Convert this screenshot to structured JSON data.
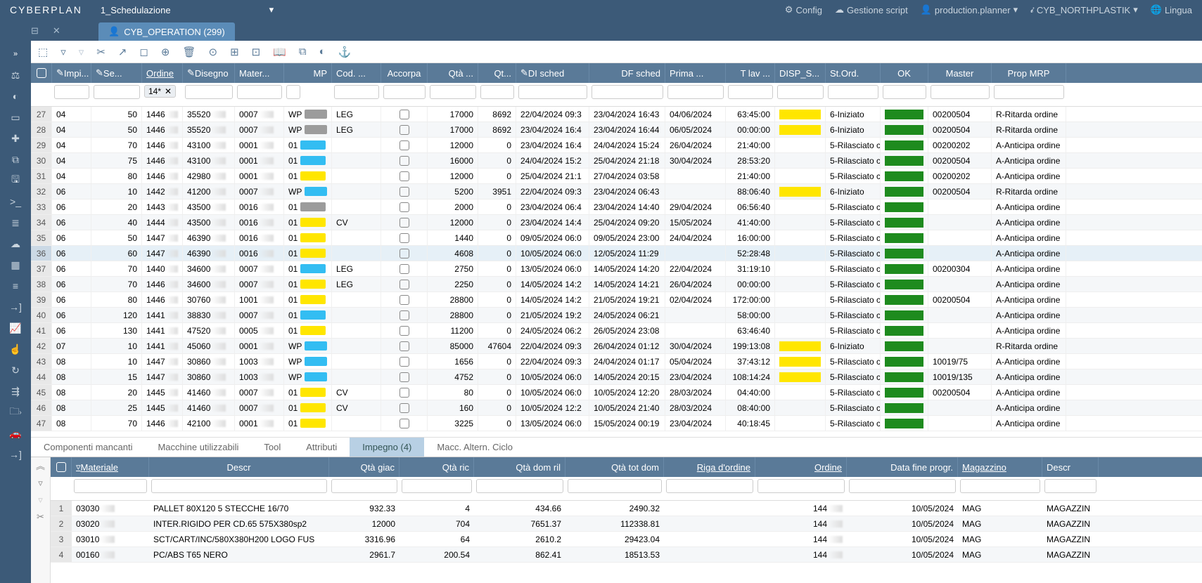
{
  "app": {
    "logo": "CYBERPLAN",
    "schedule": "1_Schedulazione"
  },
  "top_right": {
    "config": "Config",
    "script": "Gestione script",
    "user": "production.planner",
    "plant": "CYB_NORTHPLASTIK",
    "lang": "Lingua"
  },
  "tab": {
    "title": "CYB_OPERATION  (299)"
  },
  "filter_chip": "14*",
  "headers": [
    "",
    "Impi...",
    "Se...",
    "Ordine",
    "Disegno",
    "Mater...",
    "MP",
    "Cod. ...",
    "Accorpa",
    "Qtà ...",
    "Qt...",
    "DI sched",
    "DF sched",
    "Prima ...",
    "T lav ...",
    "DISP_S...",
    "St.Ord.",
    "OK",
    "Master",
    "Prop MRP"
  ],
  "rows": [
    {
      "idx": 27,
      "a": "04",
      "se": 50,
      "ord": "1446",
      "dis": "35520",
      "mat": "0007",
      "mp": "WP",
      "mpc": "gray",
      "cod": "LEG",
      "qta": 17000,
      "qt2": 8692,
      "di": "22/04/2024 09:3",
      "df": "23/04/2024 16:43",
      "prima": "04/06/2024",
      "tlav": "63:45:00",
      "disp": "y",
      "stord": "6-Iniziato",
      "mast": "00200504",
      "prop": "R-Ritarda ordine"
    },
    {
      "idx": 28,
      "a": "04",
      "se": 50,
      "ord": "1446",
      "dis": "35520",
      "mat": "0007",
      "mp": "WP",
      "mpc": "gray",
      "cod": "LEG",
      "qta": 17000,
      "qt2": 8692,
      "di": "23/04/2024 16:4",
      "df": "23/04/2024 16:44",
      "prima": "06/05/2024",
      "tlav": "00:00:00",
      "disp": "y",
      "stord": "6-Iniziato",
      "mast": "00200504",
      "prop": "R-Ritarda ordine"
    },
    {
      "idx": 29,
      "a": "04",
      "se": 70,
      "ord": "1446",
      "dis": "43100",
      "mat": "0001",
      "mp": "01",
      "mpc": "cyan",
      "cod": "",
      "qta": 12000,
      "qt2": 0,
      "di": "23/04/2024 16:4",
      "df": "24/04/2024 15:24",
      "prima": "26/04/2024",
      "tlav": "21:40:00",
      "disp": "",
      "stord": "5-Rilasciato c",
      "mast": "00200202",
      "prop": "A-Anticipa ordine"
    },
    {
      "idx": 30,
      "a": "04",
      "se": 75,
      "ord": "1446",
      "dis": "43100",
      "mat": "0001",
      "mp": "01",
      "mpc": "cyan",
      "cod": "",
      "qta": 16000,
      "qt2": 0,
      "di": "24/04/2024 15:2",
      "df": "25/04/2024 21:18",
      "prima": "30/04/2024",
      "tlav": "28:53:20",
      "disp": "",
      "stord": "5-Rilasciato c",
      "mast": "00200504",
      "prop": "A-Anticipa ordine"
    },
    {
      "idx": 31,
      "a": "04",
      "se": 80,
      "ord": "1446",
      "dis": "42980",
      "mat": "0001",
      "mp": "01",
      "mpc": "yellow",
      "cod": "",
      "qta": 12000,
      "qt2": 0,
      "di": "25/04/2024 21:1",
      "df": "27/04/2024 03:58",
      "prima": "",
      "tlav": "21:40:00",
      "disp": "",
      "stord": "5-Rilasciato c",
      "mast": "00200202",
      "prop": "A-Anticipa ordine"
    },
    {
      "idx": 32,
      "a": "06",
      "se": 10,
      "ord": "1442",
      "dis": "41200",
      "mat": "0007",
      "mp": "WP",
      "mpc": "cyan",
      "cod": "",
      "qta": 5200,
      "qt2": 3951,
      "di": "22/04/2024 09:3",
      "df": "23/04/2024 06:43",
      "prima": "",
      "tlav": "88:06:40",
      "disp": "y",
      "stord": "6-Iniziato",
      "mast": "00200504",
      "prop": "R-Ritarda ordine"
    },
    {
      "idx": 33,
      "a": "06",
      "se": 20,
      "ord": "1443",
      "dis": "43500",
      "mat": "0016",
      "mp": "01",
      "mpc": "gray",
      "cod": "",
      "qta": 2000,
      "qt2": 0,
      "di": "23/04/2024 06:4",
      "df": "23/04/2024 14:40",
      "prima": "29/04/2024",
      "tlav": "06:56:40",
      "disp": "",
      "stord": "5-Rilasciato c",
      "mast": "",
      "prop": "A-Anticipa ordine"
    },
    {
      "idx": 34,
      "a": "06",
      "se": 40,
      "ord": "1444",
      "dis": "43500",
      "mat": "0016",
      "mp": "01",
      "mpc": "yellow",
      "cod": "CV",
      "qta": 12000,
      "qt2": 0,
      "di": "23/04/2024 14:4",
      "df": "25/04/2024 09:20",
      "prima": "15/05/2024",
      "tlav": "41:40:00",
      "disp": "",
      "stord": "5-Rilasciato c",
      "mast": "",
      "prop": "A-Anticipa ordine"
    },
    {
      "idx": 35,
      "a": "06",
      "se": 50,
      "ord": "1447",
      "dis": "46390",
      "mat": "0016",
      "mp": "01",
      "mpc": "yellow",
      "cod": "",
      "qta": 1440,
      "qt2": 0,
      "di": "09/05/2024 06:0",
      "df": "09/05/2024 23:00",
      "prima": "24/04/2024",
      "tlav": "16:00:00",
      "disp": "",
      "stord": "5-Rilasciato c",
      "mast": "",
      "prop": "A-Anticipa ordine"
    },
    {
      "idx": 36,
      "a": "06",
      "se": 60,
      "ord": "1447",
      "dis": "46390",
      "mat": "0016",
      "mp": "01",
      "mpc": "yellow",
      "cod": "",
      "qta": 4608,
      "qt2": 0,
      "di": "10/05/2024 06:0",
      "df": "12/05/2024 11:29",
      "prima": "",
      "tlav": "52:28:48",
      "disp": "",
      "stord": "5-Rilasciato c",
      "mast": "",
      "prop": "A-Anticipa ordine",
      "sel": true
    },
    {
      "idx": 37,
      "a": "06",
      "se": 70,
      "ord": "1440",
      "dis": "34600",
      "mat": "0007",
      "mp": "01",
      "mpc": "cyan",
      "cod": "LEG",
      "qta": 2750,
      "qt2": 0,
      "di": "13/05/2024 06:0",
      "df": "14/05/2024 14:20",
      "prima": "22/04/2024",
      "tlav": "31:19:10",
      "disp": "",
      "stord": "5-Rilasciato c",
      "mast": "00200304",
      "prop": "A-Anticipa ordine"
    },
    {
      "idx": 38,
      "a": "06",
      "se": 70,
      "ord": "1446",
      "dis": "34600",
      "mat": "0007",
      "mp": "01",
      "mpc": "yellow",
      "cod": "LEG",
      "qta": 2250,
      "qt2": 0,
      "di": "14/05/2024 14:2",
      "df": "14/05/2024 14:21",
      "prima": "26/04/2024",
      "tlav": "00:00:00",
      "disp": "",
      "stord": "5-Rilasciato c",
      "mast": "",
      "prop": "A-Anticipa ordine"
    },
    {
      "idx": 39,
      "a": "06",
      "se": 80,
      "ord": "1446",
      "dis": "30760",
      "mat": "1001",
      "mp": "01",
      "mpc": "yellow",
      "cod": "",
      "qta": 28800,
      "qt2": 0,
      "di": "14/05/2024 14:2",
      "df": "21/05/2024 19:21",
      "prima": "02/04/2024",
      "tlav": "172:00:00",
      "disp": "",
      "stord": "5-Rilasciato c",
      "mast": "00200504",
      "prop": "A-Anticipa ordine"
    },
    {
      "idx": 40,
      "a": "06",
      "se": 120,
      "ord": "1441",
      "dis": "38830",
      "mat": "0007",
      "mp": "01",
      "mpc": "cyan",
      "cod": "",
      "qta": 28800,
      "qt2": 0,
      "di": "21/05/2024 19:2",
      "df": "24/05/2024 06:21",
      "prima": "",
      "tlav": "58:00:00",
      "disp": "",
      "stord": "5-Rilasciato c",
      "mast": "",
      "prop": "A-Anticipa ordine"
    },
    {
      "idx": 41,
      "a": "06",
      "se": 130,
      "ord": "1441",
      "dis": "47520",
      "mat": "0005",
      "mp": "01",
      "mpc": "yellow",
      "cod": "",
      "qta": 11200,
      "qt2": 0,
      "di": "24/05/2024 06:2",
      "df": "26/05/2024 23:08",
      "prima": "",
      "tlav": "63:46:40",
      "disp": "",
      "stord": "5-Rilasciato c",
      "mast": "",
      "prop": "A-Anticipa ordine"
    },
    {
      "idx": 42,
      "a": "07",
      "se": 10,
      "ord": "1441",
      "dis": "45060",
      "mat": "0001",
      "mp": "WP",
      "mpc": "cyan",
      "cod": "",
      "qta": 85000,
      "qt2": 47604,
      "di": "22/04/2024 09:3",
      "df": "26/04/2024 01:12",
      "prima": "30/04/2024",
      "tlav": "199:13:08",
      "disp": "y",
      "stord": "6-Iniziato",
      "mast": "",
      "prop": "R-Ritarda ordine"
    },
    {
      "idx": 43,
      "a": "08",
      "se": 10,
      "ord": "1447",
      "dis": "30860",
      "mat": "1003",
      "mp": "WP",
      "mpc": "cyan",
      "cod": "",
      "qta": 1656,
      "qt2": 0,
      "di": "22/04/2024 09:3",
      "df": "24/04/2024 01:17",
      "prima": "05/04/2024",
      "tlav": "37:43:12",
      "disp": "y",
      "stord": "5-Rilasciato c",
      "mast": "10019/75",
      "prop": "A-Anticipa ordine"
    },
    {
      "idx": 44,
      "a": "08",
      "se": 15,
      "ord": "1447",
      "dis": "30860",
      "mat": "1003",
      "mp": "WP",
      "mpc": "cyan",
      "cod": "",
      "qta": 4752,
      "qt2": 0,
      "di": "10/05/2024 06:0",
      "df": "14/05/2024 20:15",
      "prima": "23/04/2024",
      "tlav": "108:14:24",
      "disp": "y",
      "stord": "5-Rilasciato c",
      "mast": "10019/135",
      "prop": "A-Anticipa ordine"
    },
    {
      "idx": 45,
      "a": "08",
      "se": 20,
      "ord": "1445",
      "dis": "41460",
      "mat": "0007",
      "mp": "01",
      "mpc": "yellow",
      "cod": "CV",
      "qta": 80,
      "qt2": 0,
      "di": "10/05/2024 06:0",
      "df": "10/05/2024 12:20",
      "prima": "28/03/2024",
      "tlav": "04:40:00",
      "disp": "",
      "stord": "5-Rilasciato c",
      "mast": "00200504",
      "prop": "A-Anticipa ordine"
    },
    {
      "idx": 46,
      "a": "08",
      "se": 25,
      "ord": "1445",
      "dis": "41460",
      "mat": "0007",
      "mp": "01",
      "mpc": "yellow",
      "cod": "CV",
      "qta": 160,
      "qt2": 0,
      "di": "10/05/2024 12:2",
      "df": "10/05/2024 21:40",
      "prima": "28/03/2024",
      "tlav": "08:40:00",
      "disp": "",
      "stord": "5-Rilasciato c",
      "mast": "",
      "prop": "A-Anticipa ordine"
    },
    {
      "idx": 47,
      "a": "08",
      "se": 70,
      "ord": "1446",
      "dis": "42100",
      "mat": "0001",
      "mp": "01",
      "mpc": "yellow",
      "cod": "",
      "qta": 3225,
      "qt2": 0,
      "di": "13/05/2024 06:0",
      "df": "15/05/2024 00:19",
      "prima": "23/04/2024",
      "tlav": "40:18:45",
      "disp": "",
      "stord": "5-Rilasciato c",
      "mast": "",
      "prop": "A-Anticipa ordine"
    }
  ],
  "sub_tabs": [
    "Componenti mancanti",
    "Macchine utilizzabili",
    "Tool",
    "Attributi",
    "Impegno (4)",
    "Macc. Altern. Ciclo"
  ],
  "sub_active": 4,
  "lower_headers": [
    "Materiale",
    "Descr",
    "Qtà giac",
    "Qtà ric",
    "Qtà dom ril",
    "Qtà tot dom",
    "Riga d'ordine",
    "Ordine",
    "Data fine progr.",
    "Magazzino",
    "Descr"
  ],
  "lower_rows": [
    {
      "idx": 1,
      "mat": "03030",
      "desc": "PALLET 80X120 5 STECCHE 16/70",
      "giac": "932.33",
      "ric": "4",
      "dom": "434.66",
      "tot": "2490.32",
      "riga": "",
      "ord": "144",
      "data": "10/05/2024",
      "mag": "MAG",
      "d2": "MAGAZZIN"
    },
    {
      "idx": 2,
      "mat": "03020",
      "desc": "INTER.RIGIDO PER CD.65 575X380sp2",
      "giac": "12000",
      "ric": "704",
      "dom": "7651.37",
      "tot": "112338.81",
      "riga": "",
      "ord": "144",
      "data": "10/05/2024",
      "mag": "MAG",
      "d2": "MAGAZZIN"
    },
    {
      "idx": 3,
      "mat": "03010",
      "desc": "SCT/CART/INC/580X380H200 LOGO FUS",
      "giac": "3316.96",
      "ric": "64",
      "dom": "2610.2",
      "tot": "29423.04",
      "riga": "",
      "ord": "144",
      "data": "10/05/2024",
      "mag": "MAG",
      "d2": "MAGAZZIN"
    },
    {
      "idx": 4,
      "mat": "00160",
      "desc": "PC/ABS T65 NERO",
      "giac": "2961.7",
      "ric": "200.54",
      "dom": "862.41",
      "tot": "18513.53",
      "riga": "",
      "ord": "144",
      "data": "10/05/2024",
      "mag": "MAG",
      "d2": "MAGAZZIN"
    }
  ]
}
